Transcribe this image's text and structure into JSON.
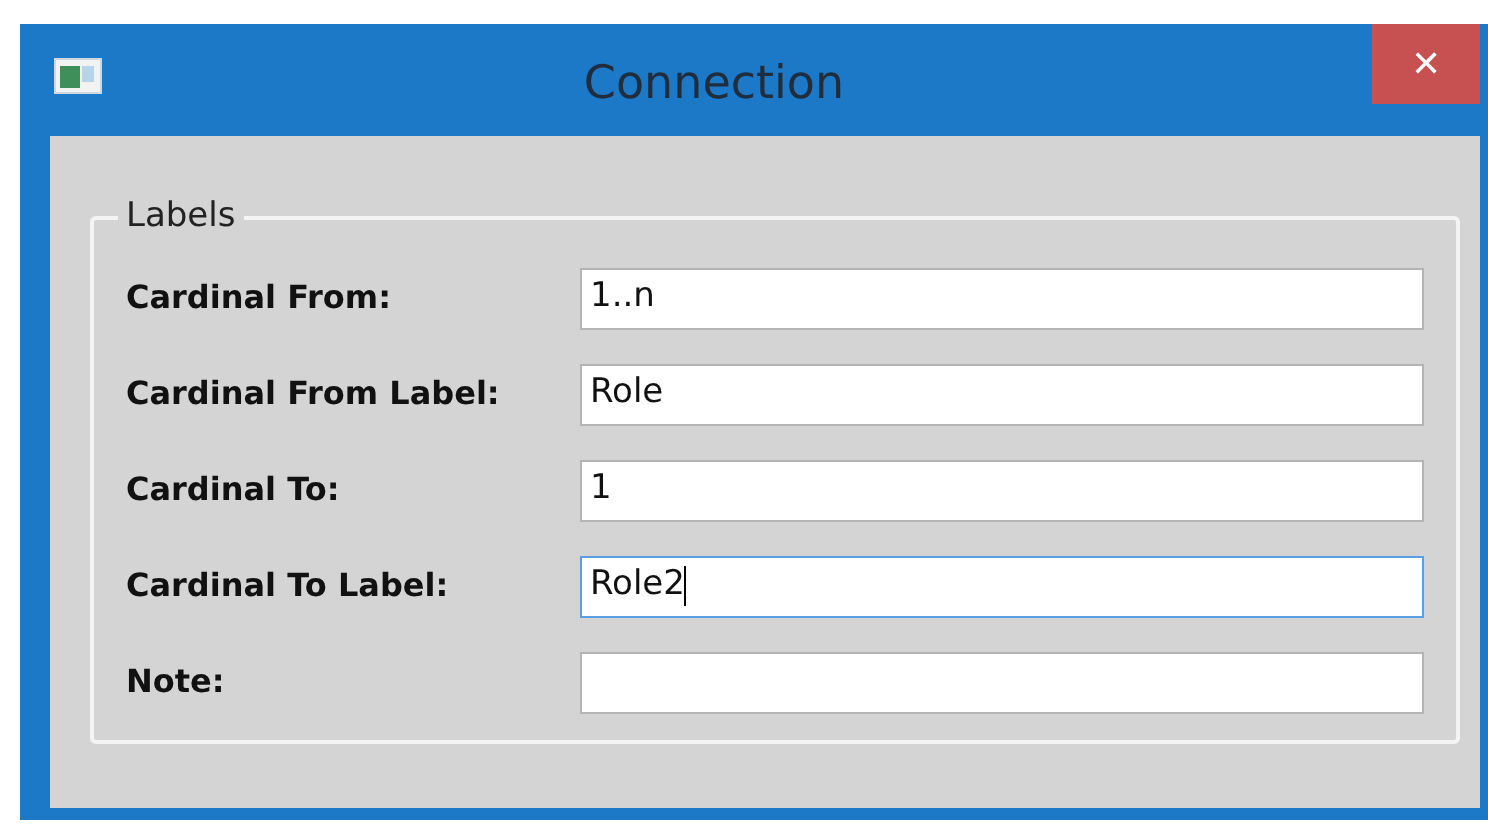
{
  "window": {
    "title": "Connection",
    "close": "✕"
  },
  "group": {
    "title": "Labels",
    "fields": [
      {
        "label": "Cardinal From:",
        "value": "1..n",
        "focused": false
      },
      {
        "label": "Cardinal From Label:",
        "value": "Role",
        "focused": false
      },
      {
        "label": "Cardinal To:",
        "value": "1",
        "focused": false
      },
      {
        "label": "Cardinal To Label:",
        "value": "Role2",
        "focused": true
      },
      {
        "label": "Note:",
        "focused": false
      }
    ]
  }
}
